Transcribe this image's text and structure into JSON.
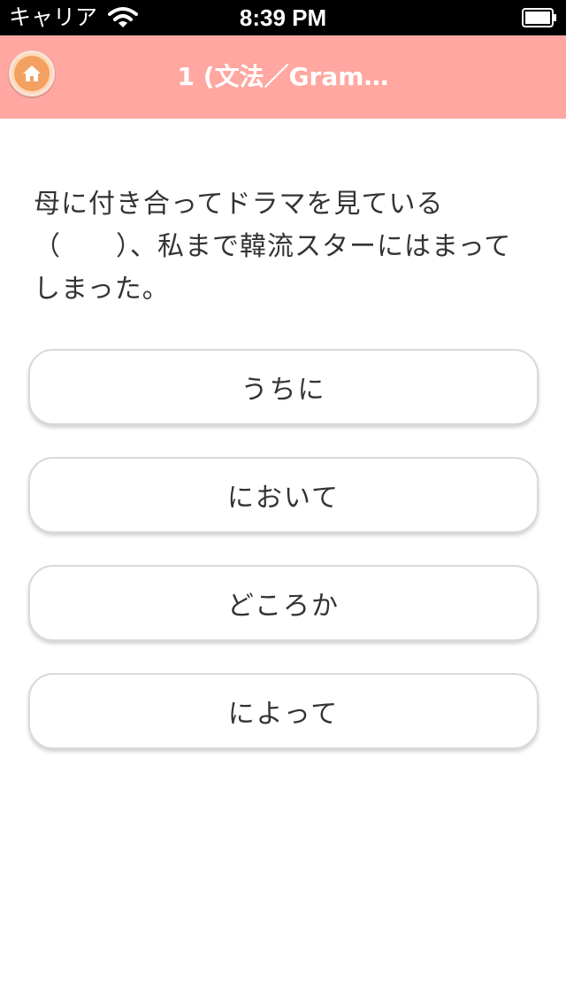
{
  "status_bar": {
    "carrier": "キャリア",
    "time": "8:39 PM",
    "wifi_icon": "wifi-icon",
    "battery_icon": "battery-icon"
  },
  "nav": {
    "home_icon": "home-icon",
    "title": "1 (文法／Gram…"
  },
  "question": {
    "text": "母に付き合ってドラマを見ている（　　）、私まで韓流スターにはまってしまった。"
  },
  "answers": [
    {
      "label": "うちに"
    },
    {
      "label": "において"
    },
    {
      "label": "どころか"
    },
    {
      "label": "によって"
    }
  ],
  "colors": {
    "nav_background": "#ffa7a0",
    "home_button": "#f3a060",
    "status_bar": "#000000"
  }
}
